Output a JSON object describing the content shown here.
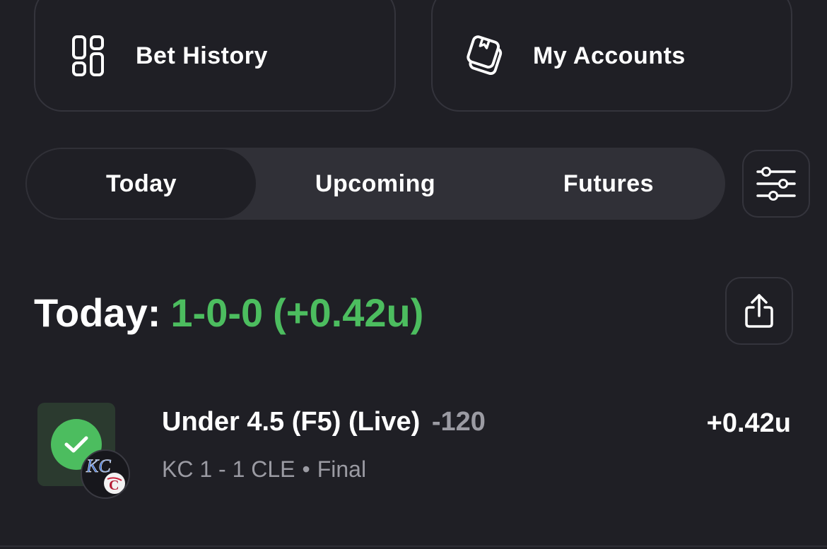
{
  "colors": {
    "background": "#1f1f25",
    "accent_green": "#4cbd5f",
    "muted_text": "#9b9ba3",
    "border": "#34343c"
  },
  "cards": {
    "bet_history": {
      "label": "Bet History",
      "icon": "grid-layout-icon"
    },
    "my_accounts": {
      "label": "My Accounts",
      "icon": "stacked-cards-icon"
    }
  },
  "tabs": {
    "items": [
      {
        "label": "Today",
        "selected": true
      },
      {
        "label": "Upcoming",
        "selected": false
      },
      {
        "label": "Futures",
        "selected": false
      }
    ],
    "filter_icon": "sliders-icon"
  },
  "summary": {
    "label": "Today:",
    "record": "1-0-0",
    "units": "(+0.42u)",
    "share_icon": "share-icon"
  },
  "bets": [
    {
      "title": "Under 4.5 (F5) (Live)",
      "odds": "-120",
      "score": "KC 1 - 1 CLE",
      "separator": "•",
      "status": "Final",
      "result": "+0.42u",
      "status_icon": "check-icon"
    }
  ]
}
